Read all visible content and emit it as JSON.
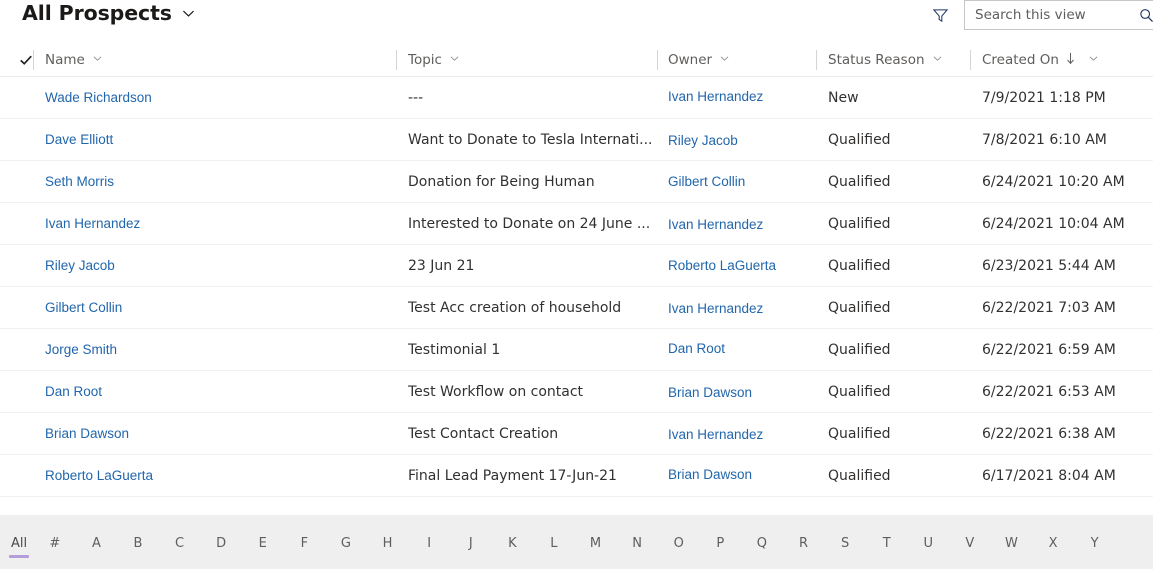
{
  "header": {
    "view_title": "All Prospects",
    "view_chevron_icon": "chevron-down-icon",
    "filter_icon": "filter-funnel-icon",
    "search_icon": "search-magnifier-icon",
    "search_placeholder": "Search this view",
    "search_value": ""
  },
  "grid": {
    "select_all_icon": "checkmark-icon",
    "columns": [
      {
        "key": "name",
        "label": "Name",
        "sorted": false
      },
      {
        "key": "topic",
        "label": "Topic",
        "sorted": false
      },
      {
        "key": "owner",
        "label": "Owner",
        "sorted": false
      },
      {
        "key": "status",
        "label": "Status Reason",
        "sorted": false
      },
      {
        "key": "date",
        "label": "Created On",
        "sorted": true,
        "sort_icon": "sort-descending-arrow"
      }
    ],
    "rows": [
      {
        "name": "Wade Richardson",
        "topic": "---",
        "owner": "Ivan Hernandez",
        "status": "New",
        "date": "7/9/2021 1:18 PM"
      },
      {
        "name": "Dave Elliott",
        "topic": "Want to Donate to Tesla Internati...",
        "owner": "Riley Jacob",
        "status": "Qualified",
        "date": "7/8/2021 6:10 AM"
      },
      {
        "name": "Seth Morris",
        "topic": "Donation for Being Human",
        "owner": "Gilbert Collin",
        "status": "Qualified",
        "date": "6/24/2021 10:20 AM"
      },
      {
        "name": "Ivan Hernandez",
        "topic": "Interested to Donate on 24 June ...",
        "owner": "Ivan Hernandez",
        "status": "Qualified",
        "date": "6/24/2021 10:04 AM"
      },
      {
        "name": "Riley Jacob",
        "topic": "23 Jun 21",
        "owner": "Roberto LaGuerta",
        "status": "Qualified",
        "date": "6/23/2021 5:44 AM"
      },
      {
        "name": "Gilbert Collin",
        "topic": "Test Acc creation of household",
        "owner": "Ivan Hernandez",
        "status": "Qualified",
        "date": "6/22/2021 7:03 AM"
      },
      {
        "name": "Jorge Smith",
        "topic": "Testimonial 1",
        "owner": "Dan Root",
        "status": "Qualified",
        "date": "6/22/2021 6:59 AM"
      },
      {
        "name": "Dan Root",
        "topic": "Test Workflow on contact",
        "owner": "Brian Dawson",
        "status": "Qualified",
        "date": "6/22/2021 6:53 AM"
      },
      {
        "name": "Brian Dawson",
        "topic": "Test Contact Creation",
        "owner": "Ivan Hernandez",
        "status": "Qualified",
        "date": "6/22/2021 6:38 AM"
      },
      {
        "name": "Roberto LaGuerta",
        "topic": "Final Lead Payment 17-Jun-21",
        "owner": "Brian Dawson",
        "status": "Qualified",
        "date": "6/17/2021 8:04 AM"
      }
    ]
  },
  "footer": {
    "selected": "All",
    "items": [
      "All",
      "#",
      "A",
      "B",
      "C",
      "D",
      "E",
      "F",
      "G",
      "H",
      "I",
      "J",
      "K",
      "L",
      "M",
      "N",
      "O",
      "P",
      "Q",
      "R",
      "S",
      "T",
      "U",
      "V",
      "W",
      "X",
      "Y"
    ]
  },
  "colors": {
    "link": "#2266ac",
    "text": "#323130",
    "muted": "#605e5c",
    "footer_bg": "#f0eff0",
    "selected_underline": "#b39ddb"
  }
}
